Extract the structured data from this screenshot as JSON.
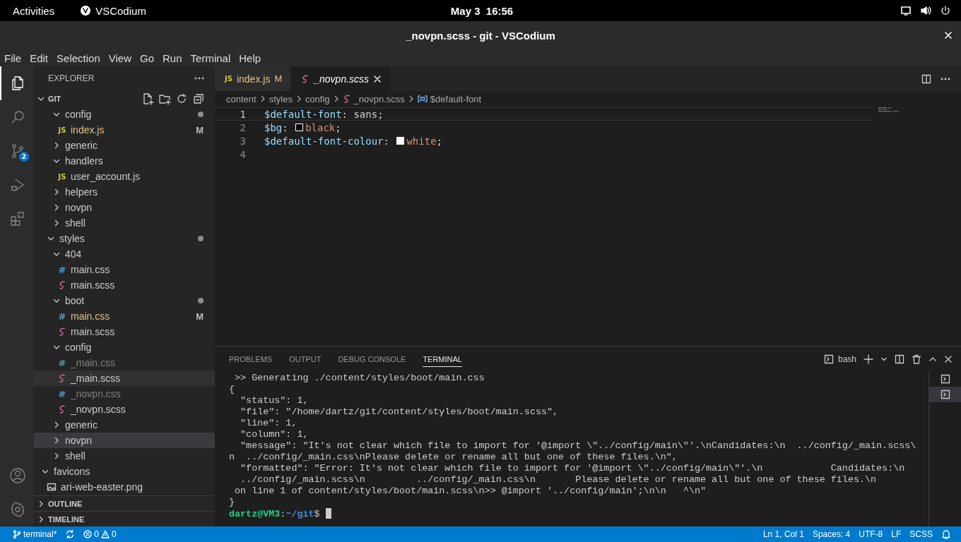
{
  "top_bar": {
    "activities": "Activities",
    "app": "VSCodium",
    "clock": "May 3  16:56"
  },
  "window": {
    "title": "_novpn.scss - git - VSCodium"
  },
  "menu": [
    "File",
    "Edit",
    "Selection",
    "View",
    "Go",
    "Run",
    "Terminal",
    "Help"
  ],
  "activity_bar": [
    {
      "kind": "explorer",
      "selected": true
    },
    {
      "kind": "search",
      "selected": false
    },
    {
      "kind": "source-control",
      "selected": false,
      "badge": "2"
    },
    {
      "kind": "run",
      "selected": false
    },
    {
      "kind": "extensions",
      "selected": false
    }
  ],
  "activity_bar_bottom": [
    {
      "kind": "account"
    },
    {
      "kind": "settings"
    }
  ],
  "sidebar": {
    "title": "EXPLORER",
    "section": {
      "title": "GIT",
      "expanded": true
    },
    "tree": [
      {
        "children": [
          {
            "children": [
              {
                "label": "config",
                "kind": "folder",
                "expanded": true,
                "modified": true,
                "selected": false,
                "hovered": false,
                "dimmed": false,
                "children": [
                  {
                    "label": "index.js",
                    "kind": "js",
                    "icon": "JS",
                    "badge": "M",
                    "selected": false,
                    "hovered": false,
                    "dimmed": false
                  }
                ]
              },
              {
                "label": "generic",
                "kind": "folder",
                "expanded": false,
                "modified": false,
                "selected": false,
                "hovered": false,
                "dimmed": false
              },
              {
                "label": "handlers",
                "kind": "folder",
                "expanded": true,
                "modified": false,
                "selected": false,
                "hovered": false,
                "dimmed": false,
                "children": [
                  {
                    "label": "user_account.js",
                    "kind": "js",
                    "icon": "JS",
                    "selected": false,
                    "hovered": false,
                    "dimmed": false
                  }
                ]
              },
              {
                "label": "helpers",
                "kind": "folder",
                "expanded": false,
                "modified": false,
                "selected": false,
                "hovered": false,
                "dimmed": false
              },
              {
                "label": "novpn",
                "kind": "folder",
                "expanded": false,
                "modified": false,
                "selected": false,
                "hovered": false,
                "dimmed": false
              },
              {
                "label": "shell",
                "kind": "folder",
                "expanded": false,
                "modified": false,
                "selected": false,
                "hovered": false,
                "dimmed": false
              }
            ]
          },
          {
            "label": "styles",
            "kind": "folder",
            "expanded": true,
            "modified": true,
            "selected": false,
            "hovered": false,
            "dimmed": false,
            "children": [
              {
                "label": "404",
                "kind": "folder",
                "expanded": true,
                "modified": false,
                "selected": false,
                "hovered": false,
                "dimmed": false,
                "children": [
                  {
                    "label": "main.css",
                    "kind": "css",
                    "icon": "#",
                    "selected": false,
                    "hovered": false,
                    "dimmed": false
                  },
                  {
                    "label": "main.scss",
                    "kind": "scss",
                    "selected": false,
                    "hovered": false,
                    "dimmed": false
                  }
                ]
              },
              {
                "label": "boot",
                "kind": "folder",
                "expanded": true,
                "modified": true,
                "selected": false,
                "hovered": false,
                "dimmed": false,
                "children": [
                  {
                    "label": "main.css",
                    "kind": "css",
                    "icon": "#",
                    "badge": "M",
                    "selected": false,
                    "hovered": false,
                    "dimmed": false
                  },
                  {
                    "label": "main.scss",
                    "kind": "scss",
                    "selected": false,
                    "hovered": false,
                    "dimmed": false
                  }
                ]
              },
              {
                "label": "config",
                "kind": "folder",
                "expanded": true,
                "modified": false,
                "selected": false,
                "hovered": false,
                "dimmed": false,
                "children": [
                  {
                    "label": "_main.css",
                    "kind": "css",
                    "icon": "#",
                    "selected": false,
                    "hovered": false,
                    "dimmed": true
                  },
                  {
                    "label": "_main.scss",
                    "kind": "scss",
                    "selected": false,
                    "hovered": true,
                    "dimmed": false
                  },
                  {
                    "label": "_novpn.css",
                    "kind": "css",
                    "icon": "#",
                    "selected": false,
                    "hovered": false,
                    "dimmed": true
                  },
                  {
                    "label": "_novpn.scss",
                    "kind": "scss",
                    "selected": false,
                    "hovered": false,
                    "dimmed": false
                  }
                ]
              },
              {
                "label": "generic",
                "kind": "folder",
                "expanded": false,
                "modified": false,
                "selected": false,
                "hovered": false,
                "dimmed": false
              },
              {
                "label": "novpn",
                "kind": "folder",
                "expanded": false,
                "modified": false,
                "selected": true,
                "hovered": false,
                "dimmed": false
              },
              {
                "label": "shell",
                "kind": "folder",
                "expanded": false,
                "modified": false,
                "selected": false,
                "hovered": false,
                "dimmed": false
              }
            ]
          }
        ]
      },
      {
        "label": "favicons",
        "kind": "folder",
        "expanded": true,
        "modified": false,
        "selected": false,
        "hovered": false,
        "dimmed": false,
        "children": [
          {
            "label": "ari-web-easter.png",
            "kind": "png",
            "selected": false,
            "hovered": false,
            "dimmed": false
          }
        ]
      }
    ],
    "bottom_sections": [
      {
        "title": "OUTLINE",
        "expanded": false
      },
      {
        "title": "TIMELINE",
        "expanded": false
      }
    ]
  },
  "tabs": [
    {
      "label": "index.js",
      "kind": "js",
      "icon": "JS",
      "badge": "M",
      "selected": false,
      "preview": false
    },
    {
      "label": "_novpn.scss",
      "kind": "scss",
      "selected": true,
      "preview": true
    }
  ],
  "breadcrumbs": [
    {
      "label": "content",
      "kind": "folder"
    },
    {
      "label": "styles",
      "kind": "folder"
    },
    {
      "label": "config",
      "kind": "folder"
    },
    {
      "label": "_novpn.scss",
      "kind": "scss"
    },
    {
      "label": "$default-font",
      "kind": "symbol"
    }
  ],
  "code": [
    {
      "number": "1",
      "current": true,
      "tokens": [
        {
          "text": "$default-font",
          "kind": "variable"
        },
        {
          "text": ": sans;",
          "kind": "plain"
        }
      ]
    },
    {
      "number": "2",
      "current": false,
      "tokens": [
        {
          "text": "$bg",
          "kind": "variable"
        },
        {
          "text": ": ",
          "kind": "plain"
        },
        {
          "kind": "swatch",
          "color": "#000000"
        },
        {
          "text": "black",
          "kind": "string"
        },
        {
          "text": ";",
          "kind": "plain"
        }
      ]
    },
    {
      "number": "3",
      "current": false,
      "tokens": [
        {
          "text": "$default-font-colour",
          "kind": "variable"
        },
        {
          "text": ": ",
          "kind": "plain"
        },
        {
          "kind": "swatch",
          "color": "#ffffff"
        },
        {
          "text": "white",
          "kind": "string"
        },
        {
          "text": ";",
          "kind": "plain"
        }
      ]
    },
    {
      "number": "4",
      "current": false
    }
  ],
  "panel": {
    "tabs": [
      {
        "label": "PROBLEMS",
        "selected": false
      },
      {
        "label": "OUTPUT",
        "selected": false
      },
      {
        "label": "DEBUG CONSOLE",
        "selected": false
      },
      {
        "label": "TERMINAL",
        "selected": true
      }
    ],
    "terminal_name": "bash",
    "lines": [
      " >> Generating ./content/styles/boot/main.css",
      "{",
      "  \"status\": 1,",
      "  \"file\": \"/home/dartz/git/content/styles/boot/main.scss\",",
      "  \"line\": 1,",
      "  \"column\": 1,",
      "  \"message\": \"It's not clear which file to import for '@import \\\"../config/main\\\"'.\\nCandidates:\\n  ../config/_main.scss\\",
      "n  ../config/_main.css\\nPlease delete or rename all but one of these files.\\n\",",
      "  \"formatted\": \"Error: It's not clear which file to import for '@import \\\"../config/main\\\"'.\\n            Candidates:\\n",
      "  ../config/_main.scss\\n         ../config/_main.css\\n       Please delete or rename all but one of these files.\\n",
      " on line 1 of content/styles/boot/main.scss\\n>> @import '../config/main';\\n\\n   ^\\n\"",
      "}"
    ],
    "prompt": {
      "user": "dartz@VM3",
      "separator": ":",
      "path": "~/git",
      "symbol": "$"
    },
    "terminals": [
      {
        "selected": false
      },
      {
        "selected": true
      }
    ]
  },
  "status_bar": {
    "branch": "terminal*",
    "errors": "0",
    "warnings": "0",
    "right": [
      "Ln 1, Col 1",
      "Spaces: 4",
      "UTF-8",
      "LF",
      "SCSS"
    ]
  }
}
